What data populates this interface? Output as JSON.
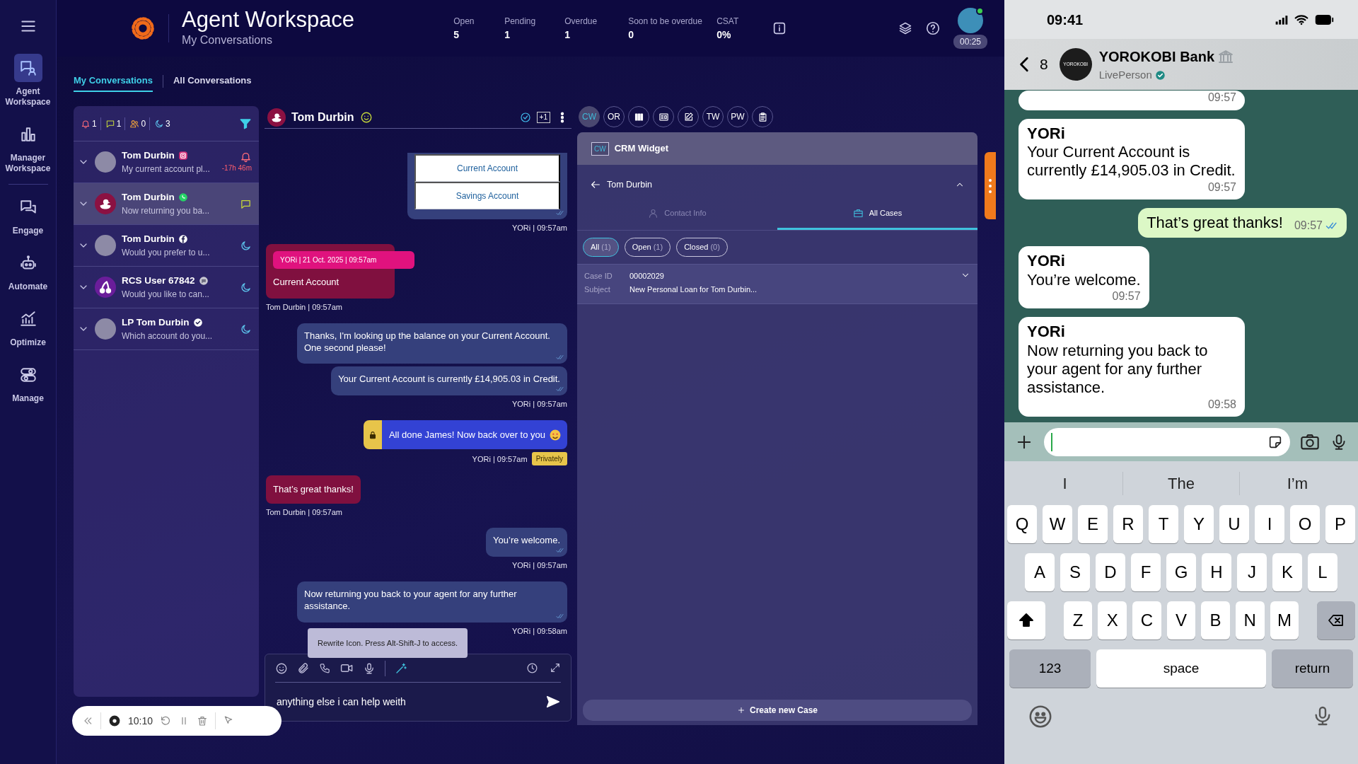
{
  "rail": {
    "items": [
      {
        "label": "Agent Workspace",
        "selected": true
      },
      {
        "label": "Manager Workspace",
        "selected": false
      },
      {
        "label": "Engage",
        "selected": false
      },
      {
        "label": "Automate",
        "selected": false
      },
      {
        "label": "Optimize",
        "selected": false
      },
      {
        "label": "Manage",
        "selected": false
      }
    ]
  },
  "header": {
    "title": "Agent Workspace",
    "subtitle": "My Conversations",
    "stats": [
      {
        "label": "Open",
        "value": "5"
      },
      {
        "label": "Pending",
        "value": "1"
      },
      {
        "label": "Overdue",
        "value": "1"
      },
      {
        "label": "Soon to be overdue",
        "value": "0"
      },
      {
        "label": "CSAT",
        "value": "0%"
      }
    ],
    "agent_online": true,
    "timer": "00:25"
  },
  "tabs": [
    {
      "label": "My Conversations",
      "selected": true
    },
    {
      "label": "All Conversations",
      "selected": false
    }
  ],
  "queue_counts": [
    {
      "kind": "alert",
      "count": "1"
    },
    {
      "kind": "message",
      "count": "1"
    },
    {
      "kind": "people",
      "count": "0"
    },
    {
      "kind": "away",
      "count": "3"
    }
  ],
  "conversations": [
    {
      "name": "Tom Durbin",
      "channel": {
        "kind": "instagram"
      },
      "avatar": {
        "kind": "photo"
      },
      "preview": "My current account pl...",
      "status": {
        "kind": "alert"
      },
      "time": "-17h 46m",
      "selected": false
    },
    {
      "name": "Tom Durbin",
      "channel": {
        "kind": "whatsapp"
      },
      "avatar": {
        "kind": "duck"
      },
      "preview": "Now returning you ba...",
      "status": {
        "kind": "message"
      },
      "selected": true
    },
    {
      "name": "Tom Durbin",
      "channel": {
        "kind": "facebook"
      },
      "avatar": {
        "kind": "photo"
      },
      "preview": "Would you prefer to u...",
      "status": {
        "kind": "away"
      },
      "selected": false
    },
    {
      "name": "RCS User 67842",
      "channel": {
        "kind": "rcs"
      },
      "avatar": {
        "kind": "cherry"
      },
      "preview": "Would you like to can...",
      "status": {
        "kind": "away"
      },
      "selected": false
    },
    {
      "name": "LP Tom Durbin",
      "channel": {
        "kind": "verified"
      },
      "avatar": {
        "kind": "photo"
      },
      "preview": "Which account do you...",
      "status": {
        "kind": "away"
      },
      "selected": false
    }
  ],
  "chat": {
    "contact": "Tom Durbin",
    "participants": "+1",
    "messages": [
      {
        "kind": "options",
        "options": [
          "Current Account",
          "Savings Account"
        ],
        "meta": "YORi | 09:57am"
      },
      {
        "kind": "quoted",
        "quote": "YORi | 21 Oct. 2025 | 09:57am",
        "text": "Current Account",
        "meta": "Tom Durbin | 09:57am"
      },
      {
        "kind": "outgoing",
        "text": "Thanks, I'm looking up the balance on your Current Account. One second please!"
      },
      {
        "kind": "outgoing",
        "text": "Your Current Account is currently £14,905.03 in Credit.",
        "meta": "YORi | 09:57am"
      },
      {
        "kind": "private",
        "text": "All done James! Now back over to you",
        "meta": "YORi | 09:57am",
        "badge": "Privately"
      },
      {
        "kind": "incoming",
        "text": "That’s great thanks!",
        "meta": "Tom Durbin | 09:57am"
      },
      {
        "kind": "outgoing",
        "text": "You’re welcome.",
        "meta": "YORi | 09:57am"
      },
      {
        "kind": "outgoing",
        "text": "Now returning you back to your agent for any further assistance.",
        "meta": "YORi | 09:58am"
      }
    ],
    "tooltip": "Rewrite Icon. Press Alt-Shift-J to access.",
    "draft": "anything else i can help weith"
  },
  "widget_tools": [
    {
      "kind": "text",
      "label": "CW",
      "selected": true
    },
    {
      "kind": "text",
      "label": "OR",
      "selected": false
    },
    {
      "kind": "icon",
      "selected": false
    },
    {
      "kind": "icon",
      "selected": false
    },
    {
      "kind": "icon",
      "selected": false
    },
    {
      "kind": "text",
      "label": "TW",
      "selected": false
    },
    {
      "kind": "text",
      "label": "PW",
      "selected": false
    },
    {
      "kind": "icon",
      "selected": false
    }
  ],
  "crm": {
    "badge": "CW",
    "title": "CRM Widget",
    "contact": "Tom Durbin",
    "tabs": [
      {
        "label": "Contact Info",
        "selected": false
      },
      {
        "label": "All Cases",
        "selected": true
      }
    ],
    "filters": [
      {
        "label": "All",
        "count": "(1)",
        "selected": true
      },
      {
        "label": "Open",
        "count": "(1)",
        "selected": false
      },
      {
        "label": "Closed",
        "count": "(0)",
        "selected": false
      }
    ],
    "cases": [
      {
        "fields": [
          {
            "label": "Case ID",
            "value": "00002029"
          },
          {
            "label": "Subject",
            "value": "New Personal Loan for Tom Durbin..."
          }
        ]
      }
    ],
    "create_button": "Create new Case"
  },
  "recorder": {
    "time": "10:10"
  },
  "phone": {
    "time": "09:41",
    "back_count": "8",
    "avatar_text": "YOROKOBI",
    "contact": "YOROKOBI Bank",
    "subtitle": "LivePerson",
    "messages": [
      {
        "kind": "incoming",
        "time": "09:57"
      },
      {
        "kind": "incoming",
        "sender": "YORi",
        "text": "Your Current Account is currently £14,905.03 in Credit.",
        "time": "09:57"
      },
      {
        "kind": "outgoing",
        "text": "That’s great thanks!",
        "time": "09:57"
      },
      {
        "kind": "incoming",
        "sender": "YORi",
        "text": "You’re welcome.",
        "time": "09:57"
      },
      {
        "kind": "incoming",
        "sender": "YORi",
        "text": "Now returning you back to your agent for any further assistance.",
        "time": "09:58"
      }
    ],
    "suggestions": [
      "I",
      "The",
      "I’m"
    ],
    "keyboard": {
      "rows": [
        [
          "Q",
          "W",
          "E",
          "R",
          "T",
          "Y",
          "U",
          "I",
          "O",
          "P"
        ],
        [
          "A",
          "S",
          "D",
          "F",
          "G",
          "H",
          "J",
          "K",
          "L"
        ],
        [
          "Z",
          "X",
          "C",
          "V",
          "B",
          "N",
          "M"
        ]
      ],
      "numbers": "123",
      "space": "space",
      "return": "return"
    }
  }
}
